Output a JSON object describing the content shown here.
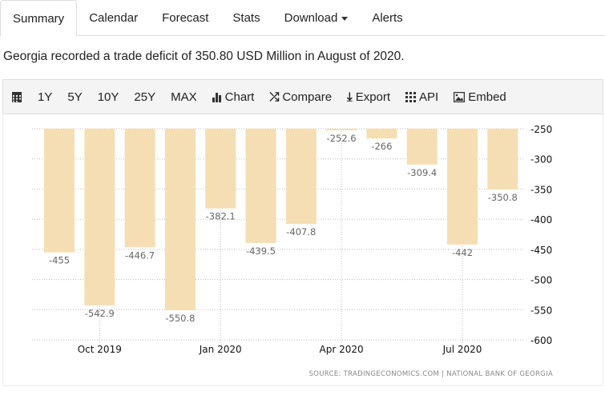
{
  "tabs": [
    "Summary",
    "Calendar",
    "Forecast",
    "Stats",
    "Download",
    "Alerts"
  ],
  "description": "Georgia recorded a trade deficit of 350.80 USD Million in August of 2020.",
  "toolbar": {
    "ranges": [
      "1Y",
      "5Y",
      "10Y",
      "25Y",
      "MAX"
    ],
    "chart": "Chart",
    "compare": "Compare",
    "export": "Export",
    "api": "API",
    "embed": "Embed"
  },
  "chart_data": {
    "type": "bar",
    "categories": [
      "Sep 2019",
      "Oct 2019",
      "Nov 2019",
      "Dec 2019",
      "Jan 2020",
      "Feb 2020",
      "Mar 2020",
      "Apr 2020",
      "May 2020",
      "Jun 2020",
      "Jul 2020",
      "Aug 2020"
    ],
    "values": [
      -455,
      -542.9,
      -446.7,
      -550.8,
      -382.1,
      -439.5,
      -407.8,
      -252.6,
      -266,
      -309.4,
      -442,
      -350.8
    ],
    "data_labels": [
      "-455",
      "-542.9",
      "-446.7",
      "-550.8",
      "-382.1",
      "-439.5",
      "-407.8",
      "-252.6",
      "-266",
      "-309.4",
      "-442",
      "-350.8"
    ],
    "x_tick_labels": [
      "Oct 2019",
      "Jan 2020",
      "Apr 2020",
      "Jul 2020"
    ],
    "y_ticks": [
      "-250",
      "-300",
      "-350",
      "-400",
      "-450",
      "-500",
      "-550",
      "-600"
    ],
    "ylim": [
      -600,
      -250
    ],
    "grid": true,
    "bar_color": "#f5deb3",
    "source": "SOURCE: TRADINGECONOMICS.COM | NATIONAL BANK OF GEORGIA"
  }
}
